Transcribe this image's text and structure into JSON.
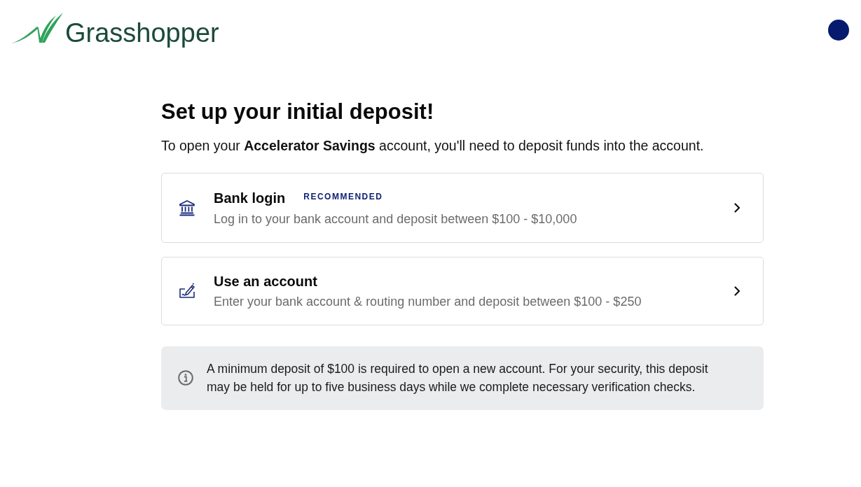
{
  "header": {
    "logo_text": "Grasshopper"
  },
  "heading": "Set up your initial deposit!",
  "intro": "To open your **Accelerator Savings** account, you'll need to deposit funds into the account.",
  "options": [
    {
      "kind": "bank",
      "title": "Bank login",
      "badge": "RECOMMENDED",
      "description": "Log in to your bank account and deposit between $100 - $10,000"
    },
    {
      "kind": "cheque",
      "title": "Use an account",
      "description": "Enter your bank account & routing number and deposit between $100 - $250"
    }
  ],
  "notice": {
    "text": "A minimum deposit of $100 is required to open a new account. For your security, this deposit may be held for up to five business days while we complete necessary verification checks."
  }
}
